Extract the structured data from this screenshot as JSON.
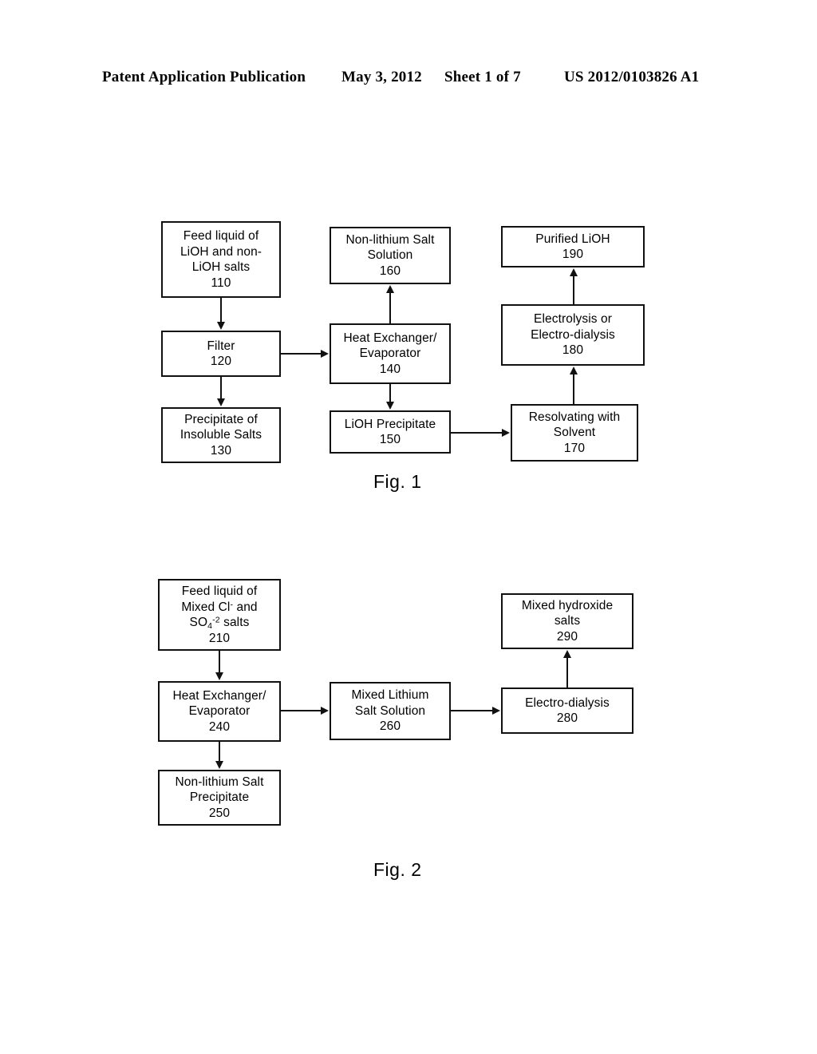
{
  "header": {
    "publication": "Patent Application Publication",
    "date": "May 3, 2012",
    "sheet": "Sheet 1 of 7",
    "number": "US 2012/0103826 A1"
  },
  "figures": [
    {
      "caption": "Fig. 1",
      "nodes": {
        "n110": {
          "l1": "Feed liquid of",
          "l2": "LiOH and non-",
          "l3": "LiOH salts",
          "ref": "110"
        },
        "n120": {
          "l1": "Filter",
          "ref": "120"
        },
        "n130": {
          "l1": "Precipitate of",
          "l2": "Insoluble Salts",
          "ref": "130"
        },
        "n140": {
          "l1": "Heat Exchanger/",
          "l2": "Evaporator",
          "ref": "140"
        },
        "n150": {
          "l1": "LiOH Precipitate",
          "ref": "150"
        },
        "n160": {
          "l1": "Non-lithium Salt",
          "l2": "Solution",
          "ref": "160"
        },
        "n170": {
          "l1": "Resolvating with",
          "l2": "Solvent",
          "ref": "170"
        },
        "n180": {
          "l1": "Electrolysis or",
          "l2": "Electro-dialysis",
          "ref": "180"
        },
        "n190": {
          "l1": "Purified LiOH",
          "ref": "190"
        }
      }
    },
    {
      "caption": "Fig. 2",
      "nodes": {
        "n210": {
          "l1": "Feed liquid of",
          "l2a": "Mixed Cl",
          "l2sup": "-",
          "l2b": " and",
          "l3a": "SO",
          "l3sub": "4",
          "l3sup": "-2",
          "l3b": " salts",
          "ref": "210"
        },
        "n240": {
          "l1": "Heat Exchanger/",
          "l2": "Evaporator",
          "ref": "240"
        },
        "n250": {
          "l1": "Non-lithium Salt",
          "l2": "Precipitate",
          "ref": "250"
        },
        "n260": {
          "l1": "Mixed Lithium",
          "l2": "Salt Solution",
          "ref": "260"
        },
        "n280": {
          "l1": "Electro-dialysis",
          "ref": "280"
        },
        "n290": {
          "l1": "Mixed hydroxide",
          "l2": "salts",
          "ref": "290"
        }
      }
    }
  ],
  "colors": {
    "ink": "#111111",
    "paper": "#ffffff"
  }
}
